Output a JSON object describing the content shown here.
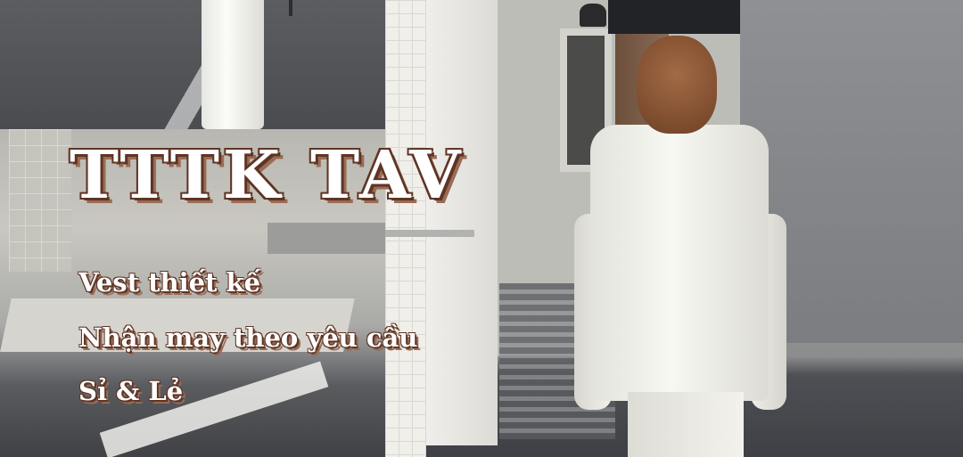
{
  "banner": {
    "headline": "TTTK TAV",
    "taglines": [
      "Vest thiết kế",
      "Nhận may theo yêu cầu",
      "Sỉ & Lẻ"
    ]
  },
  "colors": {
    "text_fill": "#ffffff",
    "text_outline": "#5e3424",
    "text_shadow": "#9a6b55"
  }
}
